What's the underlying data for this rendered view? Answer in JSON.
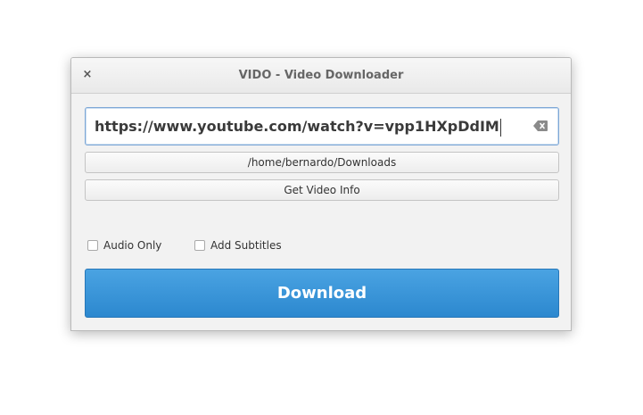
{
  "window": {
    "title": "VIDO - Video Downloader",
    "close_glyph": "×"
  },
  "url_field": {
    "value": "https://www.youtube.com/watch?v=vpp1HXpDdIM",
    "clear_icon": "backspace-clear-icon"
  },
  "folder_button": {
    "label": "/home/bernardo/Downloads"
  },
  "info_button": {
    "label": "Get Video Info"
  },
  "options": {
    "audio_only": {
      "label": "Audio Only",
      "checked": false
    },
    "add_subtitles": {
      "label": "Add Subtitles",
      "checked": false
    }
  },
  "download_button": {
    "label": "Download"
  },
  "colors": {
    "accent": "#3796da",
    "window_bg": "#f2f2f2",
    "focus_border": "#7da7d6"
  }
}
